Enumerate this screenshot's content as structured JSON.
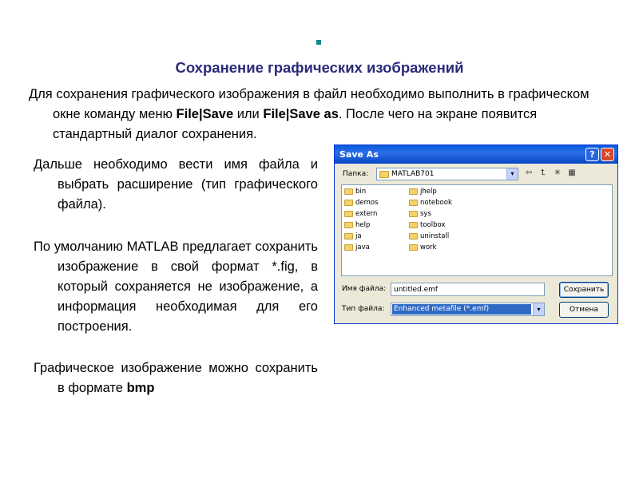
{
  "slide": {
    "title": "Сохранение графических изображений",
    "intro": {
      "part1": "Для сохранения графического изображения в файл необходимо выполнить в графическом окне команду меню ",
      "bold1": "File|Save",
      "part2": " или ",
      "bold2": "File|Save as",
      "part3": ". После чего на экране появится стандартный диалог сохранения."
    },
    "para1": "Дальше необходимо вести имя файла и выбрать расширение (тип графического файла).",
    "para2": "По умолчанию MATLAB предлагает сохранить изображение в свой формат *.fig, в который сохраняется не изображение, а информация необходимая для его построения.",
    "para3": {
      "text": "Графическое изображение можно сохранить в формате ",
      "bold": "bmp"
    }
  },
  "dialog": {
    "title": "Save As",
    "help_glyph": "?",
    "close_glyph": "✕",
    "look_in_label": "Папка:",
    "look_in_value": "MATLAB701",
    "dropdown_glyph": "▾",
    "tool_icons": [
      {
        "name": "back-icon",
        "glyph": "⇦"
      },
      {
        "name": "up-folder-icon",
        "glyph": "⮤"
      },
      {
        "name": "new-folder-icon",
        "glyph": "✳"
      },
      {
        "name": "view-menu-icon",
        "glyph": "▦"
      }
    ],
    "folders": [
      "bin",
      "demos",
      "extern",
      "help",
      "ja",
      "java",
      "jhelp",
      "notebook",
      "sys",
      "toolbox",
      "uninstall",
      "work"
    ],
    "file_name_label": "Имя файла:",
    "file_name_value": "untitled.emf",
    "file_type_label": "Тип файла:",
    "file_type_value": "Enhanced metafile (*.emf)",
    "save_button": "Сохранить",
    "cancel_button": "Отмена"
  }
}
